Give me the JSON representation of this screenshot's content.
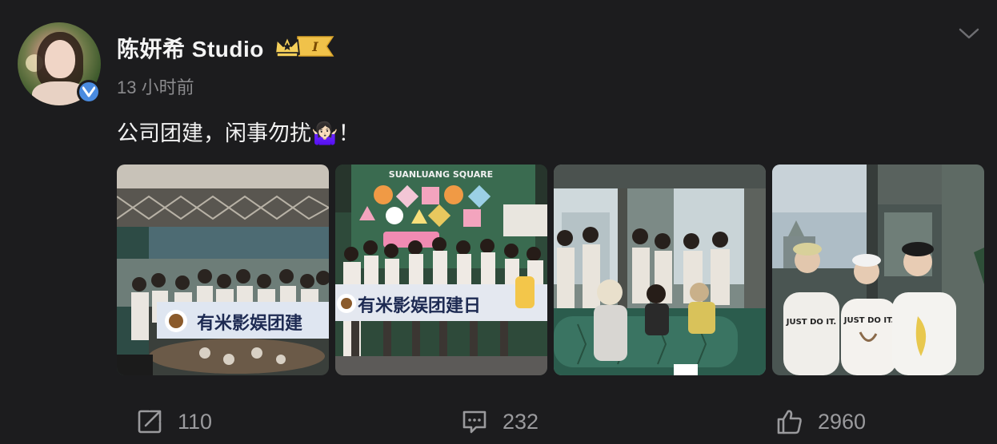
{
  "post": {
    "author": "陈妍希 Studio",
    "vip_level": "I",
    "timestamp": "13 小时前",
    "text": "公司团建，闲事勿扰🤷🏻‍♀️！",
    "photo1_banner": "有米影娱团建",
    "photo2_banner": "有米影娱团建日",
    "photo2_sign": "SUANLUANG SQUARE",
    "photo4_shirt1": "JUST DO IT.",
    "photo4_shirt2": "JUST DO IT."
  },
  "actions": {
    "repost_count": "110",
    "comment_count": "232",
    "like_count": "2960"
  },
  "colors": {
    "background": "#1c1c1e",
    "verified": "#4a8be0",
    "vip_gold": "#f0c24a",
    "secondary_text": "#8b8b8e"
  },
  "icons": [
    "verified-icon",
    "vip-crown-icon",
    "chevron-down-icon",
    "repost-icon",
    "comment-icon",
    "like-icon"
  ]
}
